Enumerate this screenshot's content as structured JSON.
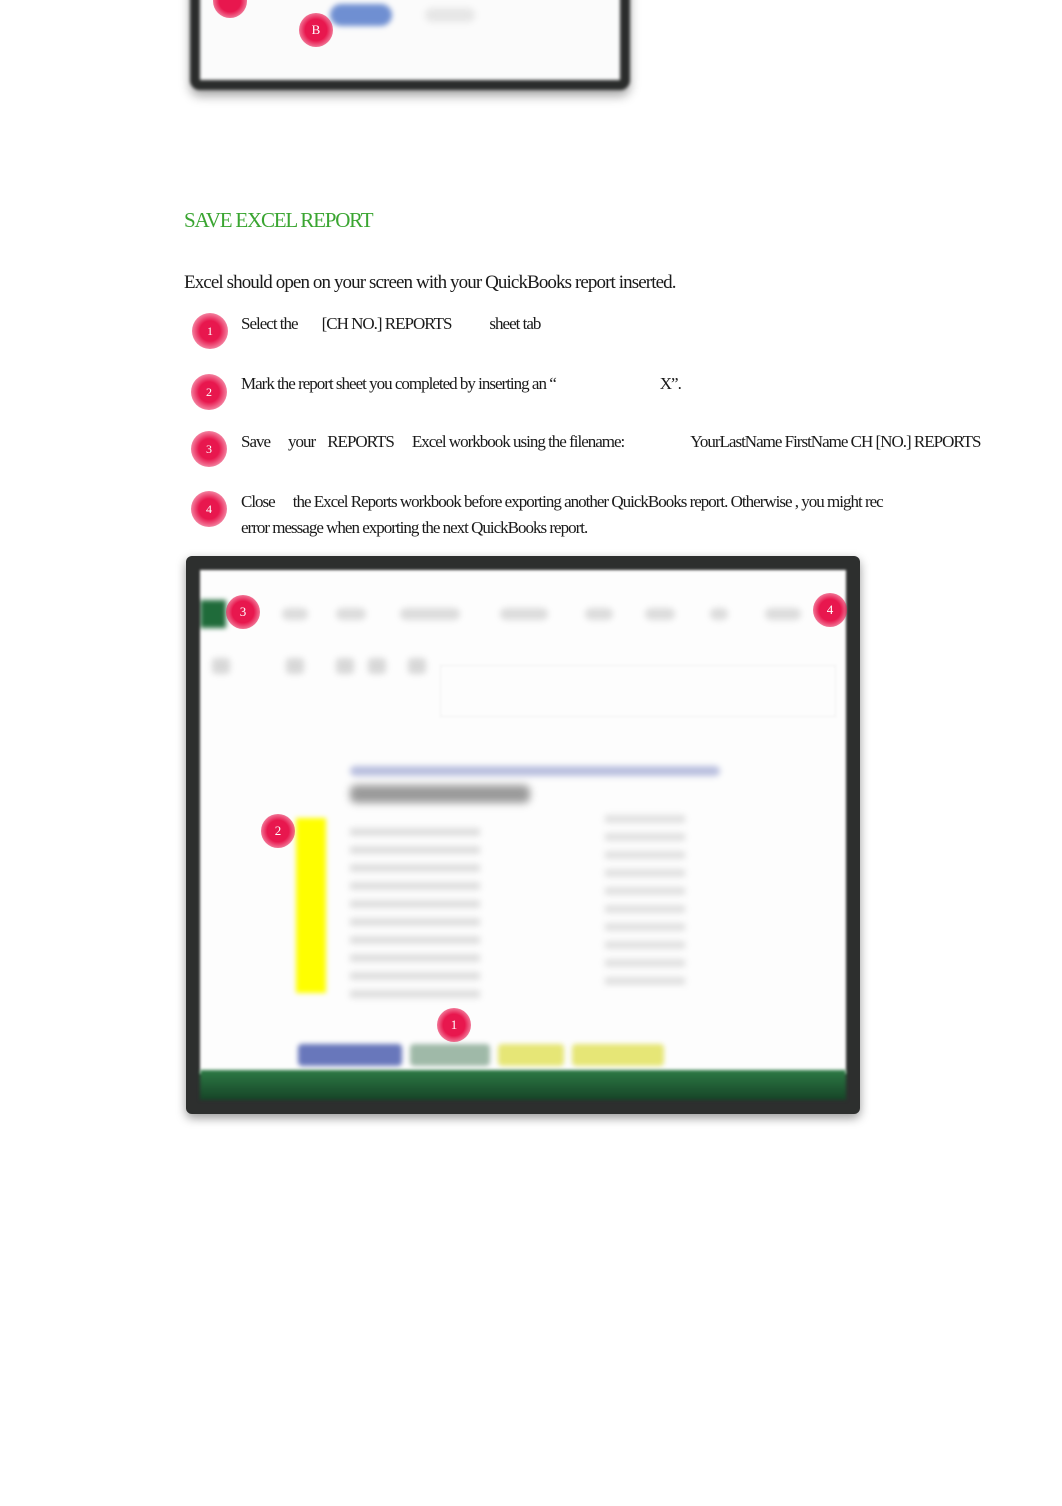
{
  "top_screenshot": {
    "marker_label": "B",
    "marker_color": "#e8174e",
    "button_color": "#6f8fd2"
  },
  "section": {
    "heading": "SAVE EXCEL REPORT",
    "heading_color": "#3aa531",
    "intro": "Excel should open on your screen with your QuickBooks report inserted."
  },
  "steps": [
    {
      "number": "1",
      "parts": [
        "Select the",
        "[CH NO.] REPORTS",
        "sheet tab"
      ]
    },
    {
      "number": "2",
      "parts": [
        "Mark the report sheet you completed by inserting an “",
        "X”."
      ]
    },
    {
      "number": "3",
      "parts": [
        "Save",
        "your",
        "REPORTS",
        "Excel workbook using the filename:",
        "YourLastName FirstName CH [NO.] REPORTS"
      ]
    },
    {
      "number": "4",
      "parts": [
        "Close",
        "the Excel Reports workbook before exporting another QuickBooks report. Otherwise , you might rec"
      ],
      "line2": "error message when exporting the next QuickBooks report."
    }
  ],
  "excel_screenshot": {
    "markers": [
      "3",
      "4",
      "2",
      "1"
    ],
    "status_bar_color": "#1f6b3a",
    "highlight_color": "#ffff00"
  }
}
